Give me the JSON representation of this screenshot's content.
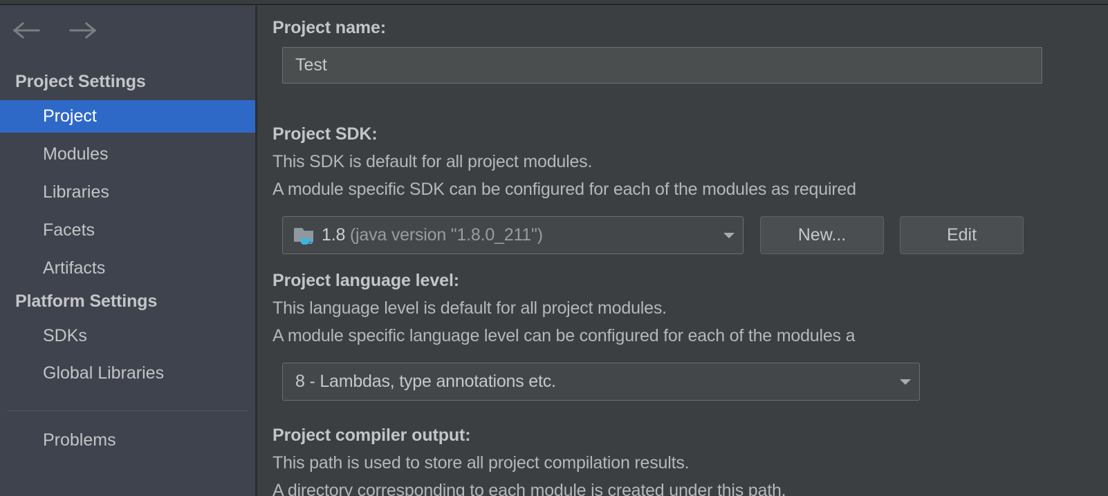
{
  "sidebar": {
    "nav": {
      "back_icon": "arrow-left-icon",
      "forward_icon": "arrow-right-icon"
    },
    "groups": [
      {
        "label": "Project Settings",
        "items": [
          {
            "label": "Project",
            "selected": true
          },
          {
            "label": "Modules",
            "selected": false
          },
          {
            "label": "Libraries",
            "selected": false
          },
          {
            "label": "Facets",
            "selected": false
          },
          {
            "label": "Artifacts",
            "selected": false
          }
        ]
      },
      {
        "label": "Platform Settings",
        "items": [
          {
            "label": "SDKs",
            "selected": false
          },
          {
            "label": "Global Libraries",
            "selected": false
          }
        ]
      }
    ],
    "footer_items": [
      {
        "label": "Problems",
        "selected": false
      }
    ]
  },
  "main": {
    "project_name": {
      "label": "Project name:",
      "value": "Test",
      "placeholder": "Project name"
    },
    "project_sdk": {
      "label": "Project SDK:",
      "description_line1": "This SDK is default for all project modules.",
      "description_line2": "A module specific SDK can be configured for each of the modules as required",
      "icon": "java-sdk-folder-icon",
      "value_primary": "1.8",
      "value_secondary": "(java version \"1.8.0_211\")",
      "caret_icon": "chevron-down-icon",
      "new_button": "New...",
      "edit_button": "Edit"
    },
    "language_level": {
      "label": "Project language level:",
      "description_line1": "This language level is default for all project modules.",
      "description_line2": "A module specific language level can be configured for each of the modules a",
      "value": "8 - Lambdas, type annotations etc.",
      "caret_icon": "chevron-down-icon"
    },
    "compiler_output": {
      "label": "Project compiler output:",
      "description_line1": "This path is used to store all project compilation results.",
      "description_line2": "A directory corresponding to each module is created under this path."
    }
  },
  "colors": {
    "sidebar_bg": "#3f434d",
    "main_bg": "#3c3f41",
    "selection_blue": "#2f69c8",
    "text_primary": "#c3c5c7",
    "text_secondary": "#b5b7b9",
    "field_bg": "#4a4e4f",
    "sdk_icon_folder": "#8f989f",
    "sdk_icon_cup": "#3cb4e0"
  }
}
